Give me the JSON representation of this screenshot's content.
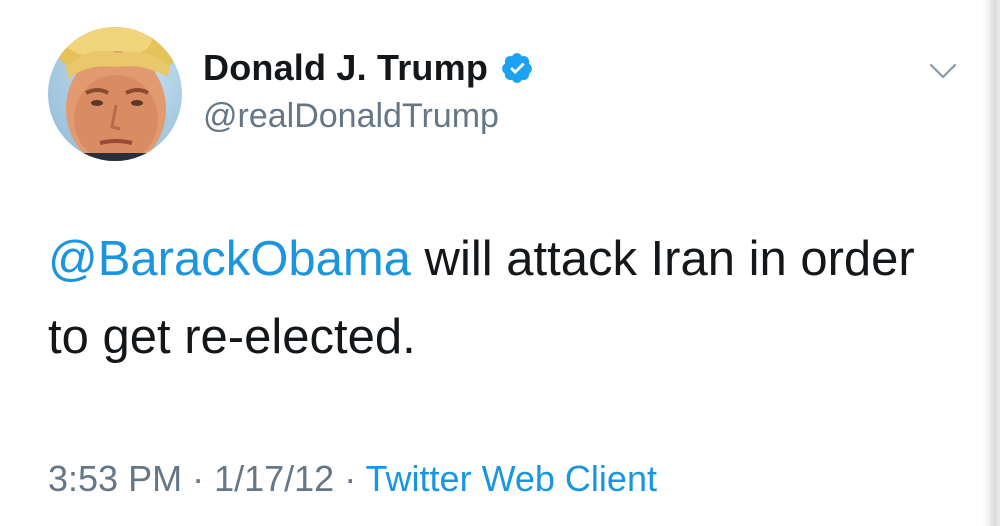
{
  "tweet": {
    "display_name": "Donald J. Trump",
    "handle": "@realDonaldTrump",
    "verified": true,
    "text_mention": "@BarackObama",
    "text_body": " will attack Iran in order to get re-elected.",
    "time": "3:53 PM",
    "separator": " · ",
    "date": "1/17/12",
    "source": "Twitter Web Client"
  },
  "icons": {
    "verified": "verified-badge-icon",
    "menu": "chevron-down-icon",
    "avatar": "profile-avatar"
  },
  "colors": {
    "link": "#1b95e0",
    "secondary_text": "#657786",
    "primary_text": "#14171a",
    "verified_badge": "#1da1f2",
    "background": "#ffffff"
  }
}
